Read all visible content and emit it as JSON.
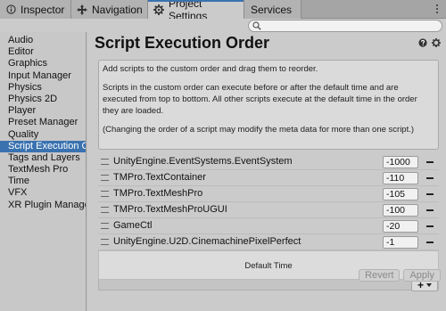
{
  "tabs": [
    {
      "label": "Inspector",
      "icon": "info-icon",
      "active": false
    },
    {
      "label": "Navigation",
      "icon": "navigation-icon",
      "active": false
    },
    {
      "label": "Project Settings",
      "icon": "gear-icon",
      "active": true
    },
    {
      "label": "Services",
      "icon": "",
      "active": false
    }
  ],
  "search": {
    "value": "",
    "placeholder": ""
  },
  "sidebar": {
    "items": [
      "Audio",
      "Editor",
      "Graphics",
      "Input Manager",
      "Physics",
      "Physics 2D",
      "Player",
      "Preset Manager",
      "Quality",
      "Script Execution Order",
      "Tags and Layers",
      "TextMesh Pro",
      "Time",
      "VFX",
      "XR Plugin Management"
    ],
    "selected": "Script Execution Order"
  },
  "main": {
    "title": "Script Execution Order",
    "help": {
      "line1": "Add scripts to the custom order and drag them to reorder.",
      "line2": "Scripts in the custom order can execute before or after the default time and are executed from top to bottom. All other scripts execute at the default time in the order they are loaded.",
      "line3": "(Changing the order of a script may modify the meta data for more than one script.)"
    },
    "scripts": [
      {
        "name": "UnityEngine.EventSystems.EventSystem",
        "order": "-1000"
      },
      {
        "name": "TMPro.TextContainer",
        "order": "-110"
      },
      {
        "name": "TMPro.TextMeshPro",
        "order": "-105"
      },
      {
        "name": "TMPro.TextMeshProUGUI",
        "order": "-100"
      },
      {
        "name": "GameCtl",
        "order": "-20"
      },
      {
        "name": "UnityEngine.U2D.CinemachinePixelPerfect",
        "order": "-1"
      }
    ],
    "default_time_label": "Default Time",
    "add_label": "+",
    "revert_label": "Revert",
    "apply_label": "Apply"
  },
  "colors": {
    "selection": "#3a72b0",
    "background": "#cbcbcb"
  }
}
